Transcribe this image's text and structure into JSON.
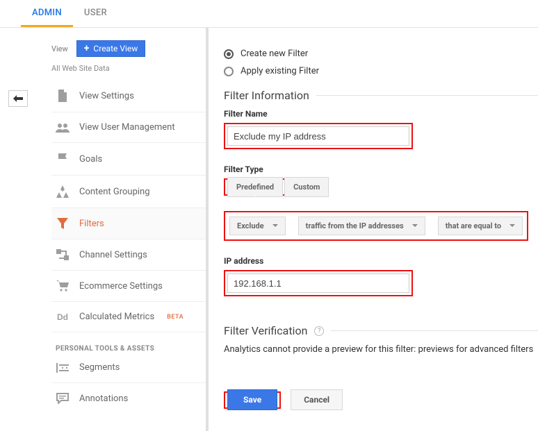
{
  "tabs": {
    "admin": "ADMIN",
    "user": "USER"
  },
  "view": {
    "label": "View",
    "create_btn": "Create View",
    "name": "All Web Site Data"
  },
  "sidebar": {
    "items": [
      {
        "label": "View Settings"
      },
      {
        "label": "View User Management"
      },
      {
        "label": "Goals"
      },
      {
        "label": "Content Grouping"
      },
      {
        "label": "Filters"
      },
      {
        "label": "Channel Settings"
      },
      {
        "label": "Ecommerce Settings"
      },
      {
        "label": "Calculated Metrics",
        "badge": "BETA"
      }
    ],
    "tools_header": "PERSONAL TOOLS & ASSETS",
    "tools": [
      {
        "label": "Segments"
      },
      {
        "label": "Annotations"
      }
    ]
  },
  "form": {
    "radio_create": "Create new Filter",
    "radio_apply": "Apply existing Filter",
    "info_header": "Filter Information",
    "filter_name_label": "Filter Name",
    "filter_name_value": "Exclude my IP address",
    "filter_type_label": "Filter Type",
    "type_predefined": "Predefined",
    "type_custom": "Custom",
    "dd_exclude": "Exclude",
    "dd_traffic": "traffic from the IP addresses",
    "dd_equal": "that are equal to",
    "ip_label": "IP address",
    "ip_value": "192.168.1.1",
    "verify_header": "Filter Verification",
    "verify_text": "Analytics cannot provide a preview for this filter: previews for advanced filters",
    "save": "Save",
    "cancel": "Cancel"
  }
}
